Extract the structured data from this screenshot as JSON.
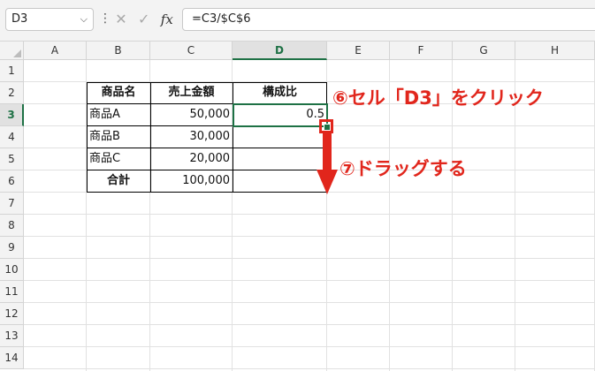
{
  "formula_bar": {
    "name_box": "D3",
    "name_box_chevron": "chevron-down-icon",
    "menu_dots": "⋮",
    "cancel_icon": "✕",
    "enter_icon": "✓",
    "fx_label": "fx",
    "formula": "=C3/$C$6"
  },
  "columns": [
    "A",
    "B",
    "C",
    "D",
    "E",
    "F",
    "G",
    "H"
  ],
  "selected_column": "D",
  "rows": [
    "1",
    "2",
    "3",
    "4",
    "5",
    "6",
    "7",
    "8",
    "9",
    "10",
    "11",
    "12",
    "13",
    "14"
  ],
  "selected_row": "3",
  "table": {
    "headers": [
      "商品名",
      "売上金額",
      "構成比"
    ],
    "rows": [
      [
        "商品A",
        "50,000",
        "0.5"
      ],
      [
        "商品B",
        "30,000",
        ""
      ],
      [
        "商品C",
        "20,000",
        ""
      ],
      [
        "合計",
        "100,000",
        ""
      ]
    ]
  },
  "annotations": {
    "step6": "⑥セル「D3」をクリック",
    "step7": "⑦ドラッグする",
    "color": "#e1261c"
  },
  "accent_color": "#1e7145"
}
